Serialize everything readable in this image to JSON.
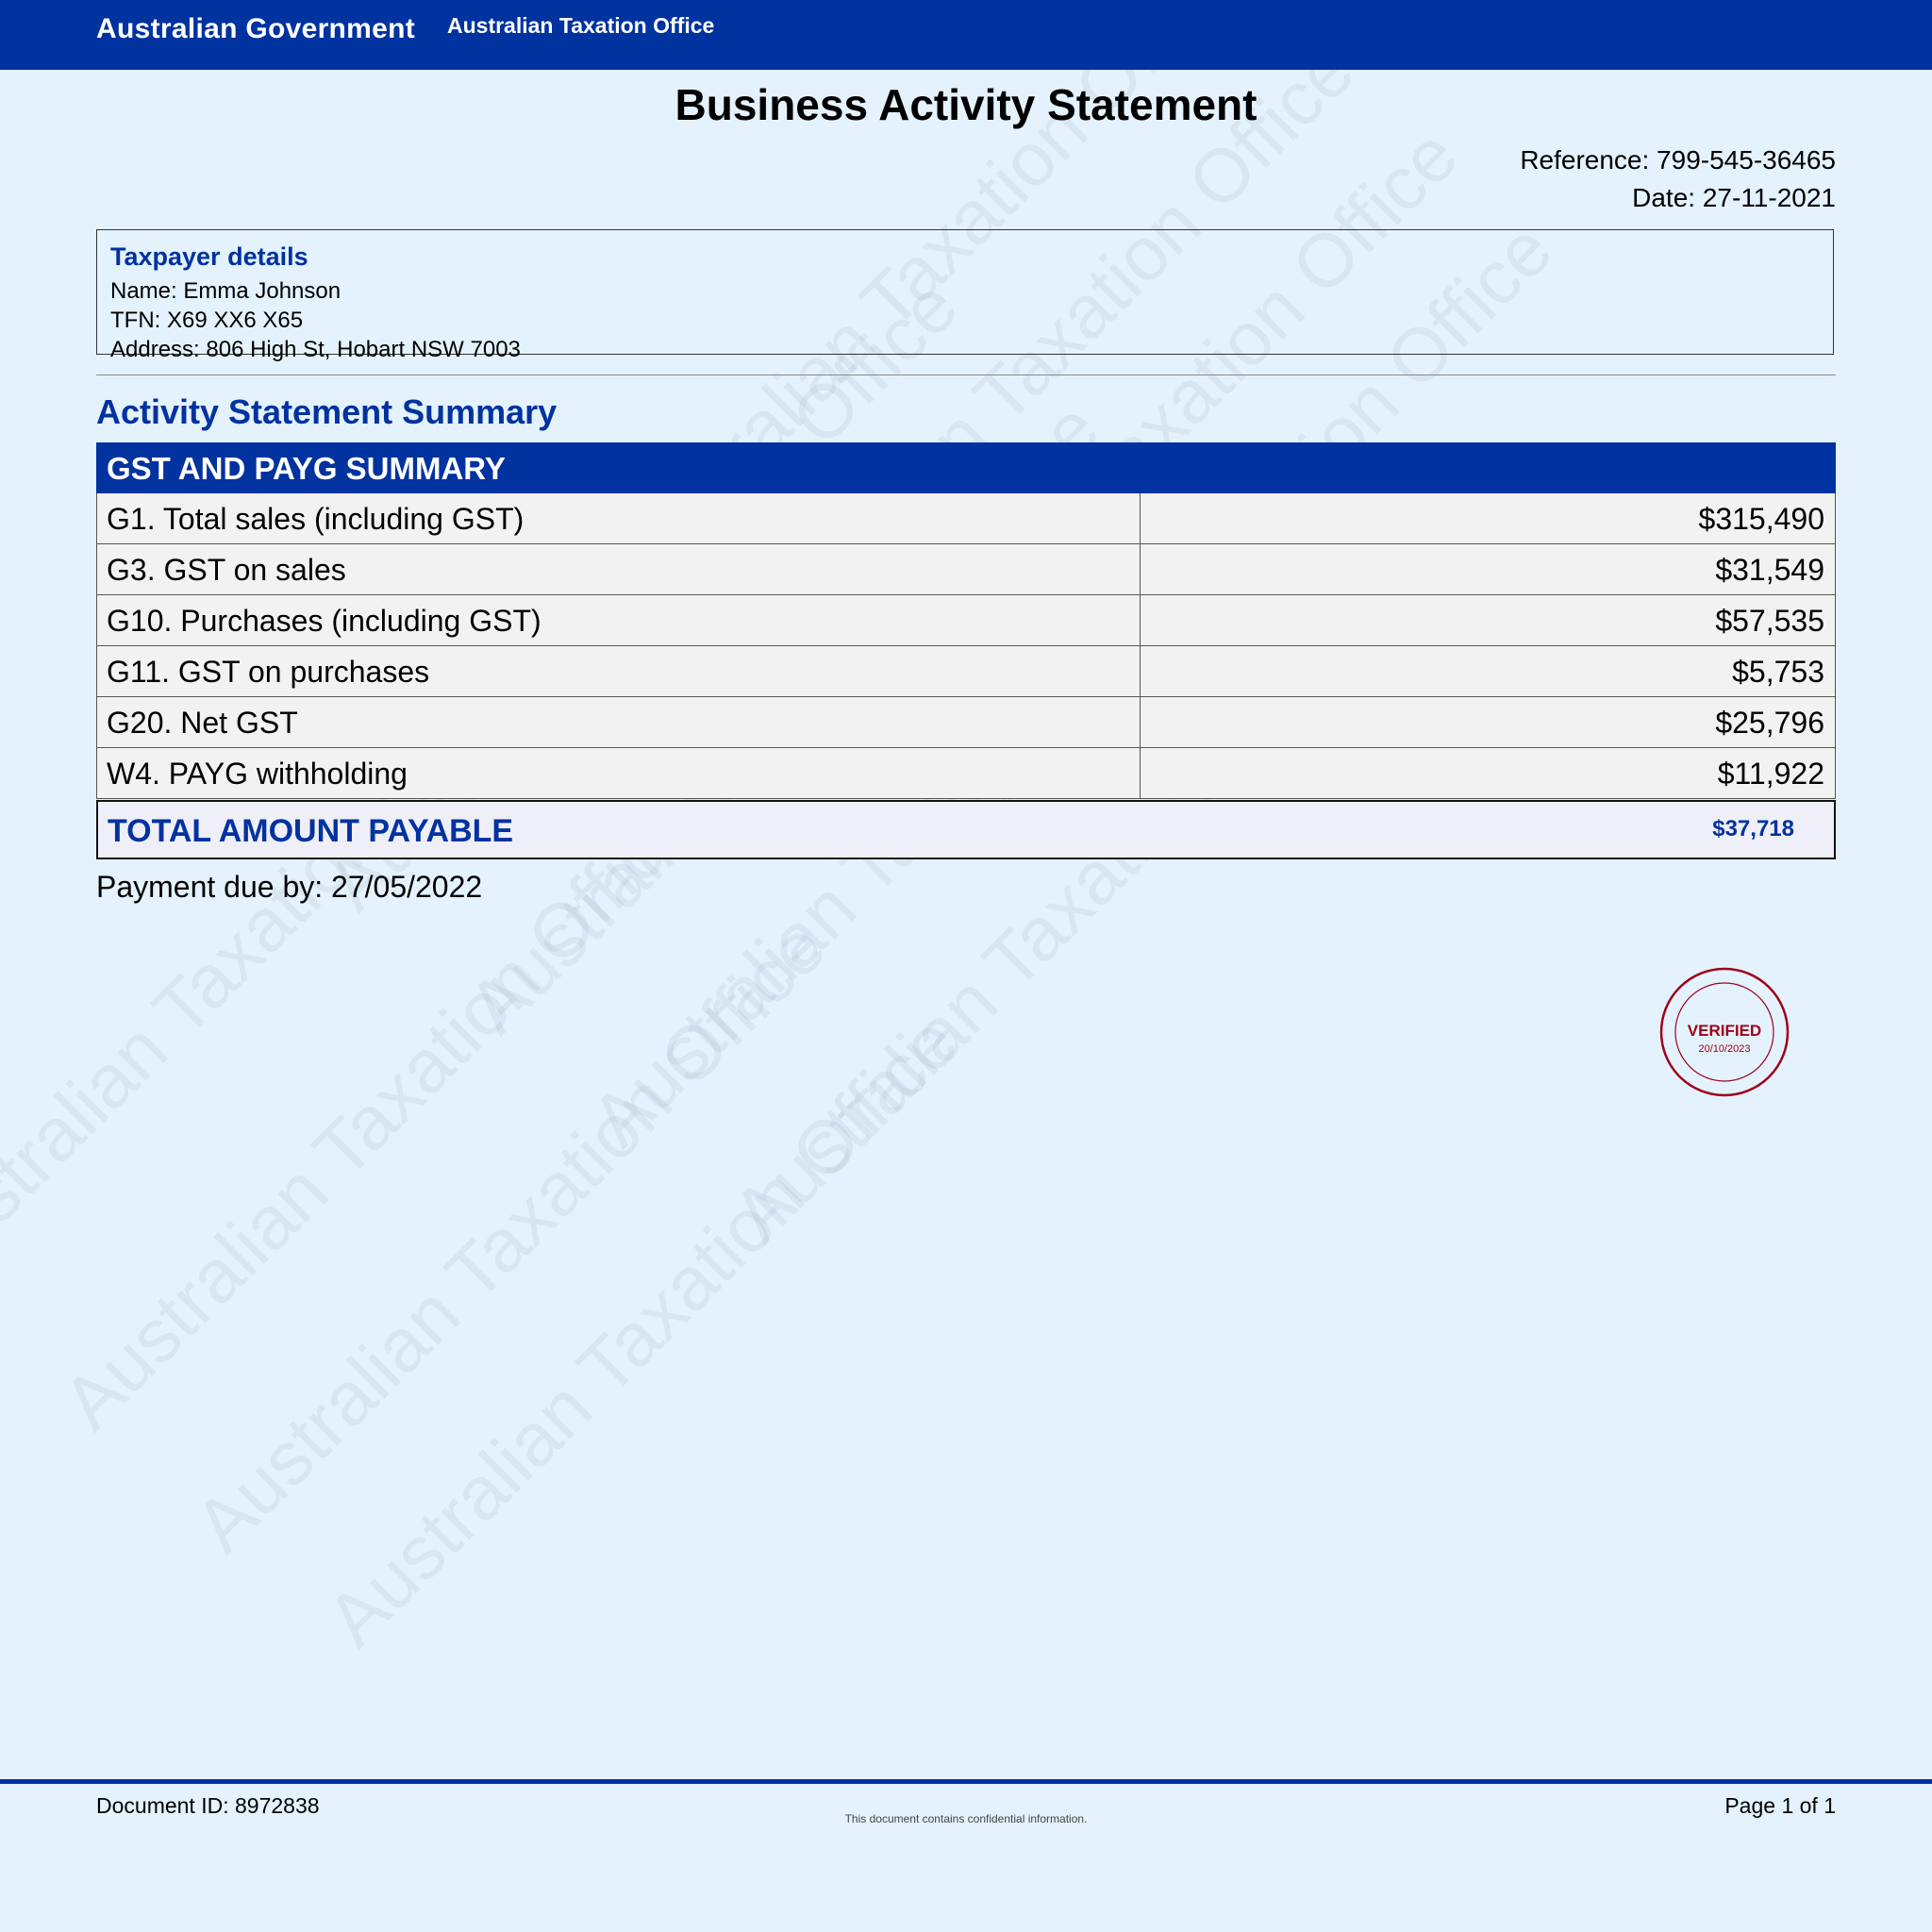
{
  "header": {
    "government": "Australian Government",
    "agency": "Australian Taxation Office"
  },
  "document": {
    "title": "Business Activity Statement",
    "reference": "Reference: 799-545-36465",
    "date": "Date: 27-11-2021"
  },
  "taxpayer": {
    "title": "Taxpayer details",
    "name": "Name: Emma Johnson",
    "tfn": "TFN: X69 XX6 X65",
    "address": "Address: 806 High St, Hobart NSW 7003"
  },
  "summary": {
    "title": "Activity Statement Summary",
    "table_header": "GST AND PAYG SUMMARY",
    "rows": [
      {
        "label": "G1. Total sales (including GST)",
        "value": "$315,490"
      },
      {
        "label": "G3. GST on sales",
        "value": "$31,549"
      },
      {
        "label": "G10. Purchases (including GST)",
        "value": "$57,535"
      },
      {
        "label": "G11. GST on purchases",
        "value": "$5,753"
      },
      {
        "label": "G20. Net GST",
        "value": "$25,796"
      },
      {
        "label": "W4. PAYG withholding",
        "value": "$11,922"
      }
    ],
    "total_label": "TOTAL AMOUNT PAYABLE",
    "total_value": "$37,718",
    "payment_due": "Payment due by: 27/05/2022"
  },
  "stamp": {
    "text": "VERIFIED",
    "date": "20/10/2023",
    "color": "#a00018"
  },
  "watermark": {
    "text": "Australian Taxation Office"
  },
  "footer": {
    "document_id": "Document ID: 8972838",
    "note": "This document contains confidential information.",
    "page": "Page 1 of 1"
  },
  "colors": {
    "brand": "#0032a0",
    "background": "#e4f2fd",
    "row_fill": "#f2f2f2",
    "total_fill": "#efeff9"
  }
}
